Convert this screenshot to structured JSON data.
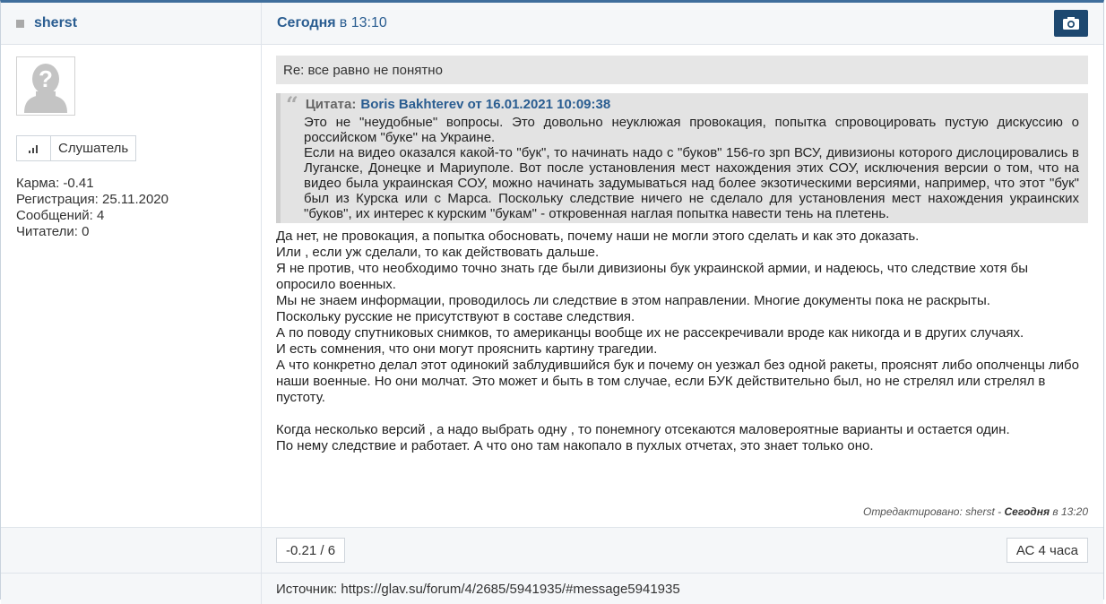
{
  "author": {
    "name": "sherst"
  },
  "post_date": {
    "day": "Сегодня",
    "time": "в 13:10"
  },
  "user": {
    "rank": "Слушатель",
    "karma": "Карма: -0.41",
    "registration": "Регистрация: 25.11.2020",
    "messages": "Сообщений: 4",
    "readers": "Читатели: 0"
  },
  "subject": "Re: все равно не понятно",
  "quote": {
    "label": "Цитата:",
    "author": "Boris Bakhterev от 16.01.2021 10:09:38",
    "lines": [
      "Это не \"неудобные\" вопросы. Это довольно неуклюжая провокация, попытка спровоцировать пустую дискуссию о российском \"буке\" на Украине.",
      "Если на видео оказался какой-то \"бук\", то начинать надо с \"буков\" 156-го зрп ВСУ, дивизионы которого дислоцировались в Луганске, Донецке и Мариуполе. Вот после установления мест нахождения этих СОУ, исключения версии о том, что на видео была украинская СОУ, можно начинать задумываться над более экзотическими версиями, например, что этот \"бук\" был из Курска или с Марса. Поскольку следствие ничего не сделало для установления мест нахождения украинских \"буков\", их интерес к курским \"букам\" - откровенная наглая попытка навести тень на плетень."
    ]
  },
  "message": {
    "lines": [
      "Да нет, не провокация, а попытка обосновать, почему наши не могли этого сделать и как это доказать.",
      "Или , если уж сделали, то как действовать дальше.",
      "Я не против, что необходимо точно знать где были дивизионы бук украинской армии, и надеюсь, что следствие хотя бы опросило военных.",
      "Мы не знаем информации, проводилось ли следствие в этом направлении. Многие документы пока не раскрыты.",
      "Поскольку русские не присутствуют в составе следствия.",
      "А по поводу спутниковых снимков, то американцы вообще их не рассекречивали вроде как никогда и в других случаях.",
      "И есть сомнения, что они могут прояснить картину трагедии.",
      "А что конкретно делал этот одинокий заблудившийся бук и почему он уезжал без одной ракеты, прояснят либо ополченцы либо",
      "наши военные. Но они молчат. Это может и быть в том случае, если БУК действительно был, но не стрелял или стрелял в пустоту.",
      "",
      "Когда несколько версий , а надо выбрать одну , то понемногу отсекаются маловероятные варианты и остается один.",
      "По нему следствие и работает. А что оно там накопало в пухлых отчетах, это знает только оно."
    ]
  },
  "edited": {
    "prefix": "Отредактировано: sherst -",
    "day": "Сегодня",
    "time": "в 13:20"
  },
  "rating": "-0.21 / 6",
  "ac_button": "АС 4 часа",
  "source": "Источник: https://glav.su/forum/4/2685/5941935/#message5941935",
  "colors": {
    "accent": "#2a5d91",
    "camera": "#1d4870"
  },
  "icons": [
    "camera-icon",
    "avatar-placeholder-icon",
    "rank-bars-icon",
    "quote-icon"
  ]
}
